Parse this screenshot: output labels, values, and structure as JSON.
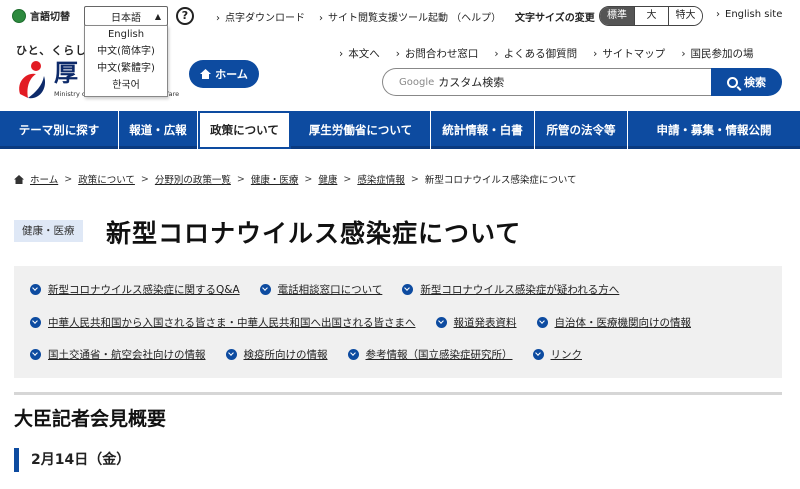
{
  "utility": {
    "language_label": "言語切替",
    "language_selected": "日本語",
    "language_options": [
      "English",
      "中文(简体字)",
      "中文(繁體字)",
      "한국어"
    ],
    "help": "?",
    "links": [
      "点字ダウンロード",
      "サイト閲覧支援ツール起動 （ヘルプ）"
    ],
    "fontsize_label": "文字サイズの変更",
    "fontsize_options": [
      "標準",
      "大",
      "特大"
    ],
    "english_site": "English site"
  },
  "header": {
    "tagline": "ひと、くらし、",
    "logo_text": "厚",
    "logo_sub": "Ministry of Health, Labour and Welfare",
    "home_button": "ホーム",
    "links": [
      "本文へ",
      "お問合わせ窓口",
      "よくある御質問",
      "サイトマップ",
      "国民参加の場"
    ],
    "search_brand": "Google",
    "search_placeholder": "カスタム検索",
    "search_button": "検索"
  },
  "nav": {
    "items": [
      "テーマ別に探す",
      "報道・広報",
      "政策について",
      "厚生労働省について",
      "統計情報・白書",
      "所管の法令等",
      "申請・募集・情報公開"
    ],
    "active_index": 2
  },
  "breadcrumb": [
    "ホーム",
    "政策について",
    "分野別の政策一覧",
    "健康・医療",
    "健康",
    "感染症情報",
    "新型コロナウイルス感染症について"
  ],
  "page": {
    "tag": "健康・医療",
    "title": "新型コロナウイルス感染症について"
  },
  "links_panel": {
    "row1": [
      "新型コロナウイルス感染症に関するQ&A",
      "電話相談窓口について",
      "新型コロナウイルス感染症が疑われる方へ"
    ],
    "row2": [
      "中華人民共和国から入国される皆さま・中華人民共和国へ出国される皆さまへ",
      "報道発表資料",
      "自治体・医療機関向けの情報"
    ],
    "row3": [
      "国土交通省・航空会社向けの情報",
      "検疫所向けの情報",
      "参考情報（国立感染症研究所）",
      "リンク"
    ]
  },
  "section": {
    "title": "大臣記者会見概要",
    "date": "2月14日（金）"
  },
  "colors": {
    "brand_blue": "#0d4ba0",
    "panel_gray": "#f0f0f0",
    "tag_bg": "#dfe8f6"
  }
}
